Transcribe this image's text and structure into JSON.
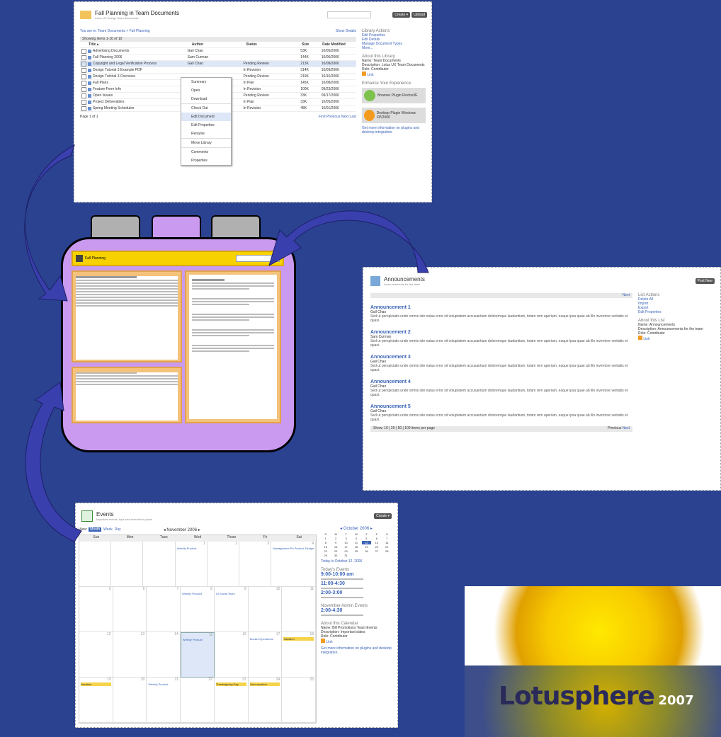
{
  "colors": {
    "background": "#2a4290",
    "device": "#c99af0",
    "panel": "#f4c27a",
    "header": "#f7d200",
    "link": "#3a63b8"
  },
  "doclib": {
    "title": "Fall Planning in Team Documents",
    "subtitle": "Lotus UX Design Team documents",
    "breadcrumb": "You are in: Team Documents > Fall Planning",
    "show_details": "Show Details",
    "create_button": "Create ▾",
    "upload_button": "Upload",
    "paging": "Showing items 1-10 of 10",
    "columns": [
      "Title ▴",
      "Author",
      "Status",
      "Size",
      "Date Modified"
    ],
    "rows": [
      {
        "title": "Advertising Documents",
        "author": "Gail Chao",
        "status": "",
        "size": "53K",
        "date": "10/05/2006"
      },
      {
        "title": "Fall Planning 2006",
        "author": "Sam Curman",
        "status": "",
        "size": "144K",
        "date": "10/06/2006"
      },
      {
        "title": "Copyright and Legal Verification Process",
        "author": "Gail Chao",
        "status": "Pending Review",
        "size": "213K",
        "date": "10/08/2006"
      },
      {
        "title": "Design Tutorial 3 Example PDF",
        "author": "",
        "status": "In Revision",
        "size": "314K",
        "date": "10/09/2006"
      },
      {
        "title": "Design Tutorial 3 Overview",
        "author": "",
        "status": "Pending Review",
        "size": "219K",
        "date": "10/10/2006"
      },
      {
        "title": "Fall Plans",
        "author": "",
        "status": "In Plan",
        "size": "145K",
        "date": "10/08/2006"
      },
      {
        "title": "Feature Form Info",
        "author": "",
        "status": "In Revision",
        "size": "100K",
        "date": "09/23/2006"
      },
      {
        "title": "Open Issues",
        "author": "",
        "status": "Pending Review",
        "size": "33K",
        "date": "09/17/2006"
      },
      {
        "title": "Project Deliverables",
        "author": "",
        "status": "In Plan",
        "size": "33K",
        "date": "10/05/2006"
      },
      {
        "title": "Spring Meeting Schedules",
        "author": "",
        "status": "In Revision",
        "size": "48K",
        "date": "10/01/2006"
      }
    ],
    "menu": [
      "Summary",
      "Open",
      "Download",
      "Check Out",
      "Edit Document",
      "Edit Properties",
      "Rename",
      "Move Library",
      "Comments",
      "Properties"
    ],
    "footer": "Page 1 of 1",
    "pager": [
      "First",
      "Previous",
      "Next",
      "Last"
    ],
    "side_title": "Library Actions",
    "side_links": [
      "Edit Properties",
      "Edit Details",
      "Manage Document Types",
      "More..."
    ],
    "about_title": "About this Library",
    "about_lines": [
      "Name: Team Documents",
      "Description: Lotus UX Team Documents",
      "Role: Contributor"
    ],
    "rss": "Link",
    "enhance_title": "Enhance Your Experience",
    "plugin1": "Browser Plugin Firefox/IE",
    "plugin2": "Desktop Plugin Windows XP/2000",
    "plugin_note": "Get more information on plugins and desktop integration."
  },
  "announcements": {
    "title": "Announcements",
    "subtitle": "Announcements for the team",
    "new_button": "Post New",
    "items": [
      {
        "title": "Announcement 1",
        "meta": "Gail Chao"
      },
      {
        "title": "Announcement 2",
        "meta": "Sam Curman"
      },
      {
        "title": "Announcement 3",
        "meta": "Gail Chao"
      },
      {
        "title": "Announcement 4",
        "meta": "Gail Chao"
      },
      {
        "title": "Announcement 5",
        "meta": "Gail Chao"
      }
    ],
    "body": "Sed ut perspiciatis unde omnis iste natus error sit voluptatem accusantium doloremque laudantium, totam rem aperiam, eaque ipsa quae ab illo inventore veritatis et quasi.",
    "pager_prev": "Previous",
    "pager_next": "Next",
    "show": "Show: 10 | 20 | 50 | 100 items per page",
    "side_title": "List Actions",
    "side_links": [
      "Delete All",
      "Import",
      "Export",
      "Edit Properties"
    ],
    "about_title": "About this List",
    "about_lines": [
      "Name: Announcements",
      "Description: Announcements for the team",
      "Role: Contributor"
    ],
    "rss": "Link"
  },
  "events": {
    "title": "Events",
    "subtitle": "Important events, trips and executive's plans",
    "create_button": "Create ▾",
    "views": [
      "View:",
      "Month",
      "Week",
      "Day"
    ],
    "month_label": "◂ November 2006 ▸",
    "days": [
      "Sun",
      "Mon",
      "Tues",
      "Wed",
      "Thurs",
      "Fri",
      "Sat"
    ],
    "weeks": [
      [
        "",
        "",
        "",
        "1",
        "2",
        "3",
        "4"
      ],
      [
        "5",
        "6",
        "7",
        "8",
        "9",
        "10",
        "11"
      ],
      [
        "12",
        "13",
        "14",
        "15",
        "16",
        "17",
        "18"
      ],
      [
        "19",
        "20",
        "21",
        "22",
        "23",
        "24",
        "25"
      ]
    ],
    "entries": [
      {
        "label": "Weekly Product",
        "cls": ""
      },
      {
        "label": "Weekly Product",
        "cls": ""
      },
      {
        "label": "UI Social Team",
        "cls": ""
      },
      {
        "label": "Weekly Product",
        "cls": ""
      },
      {
        "label": "Bucket Operations",
        "cls": ""
      },
      {
        "label": "Vacation",
        "cls": "yellow"
      },
      {
        "label": "Vacation",
        "cls": "yellow"
      },
      {
        "label": "Weekly Product",
        "cls": ""
      },
      {
        "label": "Thanksgiving Day",
        "cls": "yellow"
      },
      {
        "label": "Own vacation",
        "cls": "yellow"
      },
      {
        "label": "Management Ph Product Design",
        "cls": ""
      }
    ],
    "mini_month": "◂ October 2006 ▸",
    "mini_days": [
      "S",
      "M",
      "T",
      "W",
      "T",
      "F",
      "S"
    ],
    "mini_dates": [
      "1",
      "2",
      "3",
      "4",
      "5",
      "6",
      "7",
      "8",
      "9",
      "10",
      "11",
      "12",
      "13",
      "14",
      "15",
      "16",
      "17",
      "18",
      "19",
      "20",
      "21",
      "22",
      "23",
      "24",
      "25",
      "26",
      "27",
      "28",
      "29",
      "30",
      "31"
    ],
    "today_link": "Today is October 12, 2006",
    "todays_title": "Today's Events",
    "todays": [
      "9:00-10:00 am",
      "11:00-4:30",
      "2:00-3:00"
    ],
    "nov_title": "November Admin Events",
    "nov_event": "2:00-4:30",
    "about_title": "About this Calendar",
    "about_lines": [
      "Name: Bill Promotions Team Events",
      "Description: Important dates",
      "Role: Contributor"
    ],
    "rss": "Link",
    "note": "Get more information on plugins and desktop integration."
  },
  "device": {
    "header_label": "Fall Planning",
    "tabs": [
      "",
      "",
      ""
    ]
  },
  "logo": {
    "text": "Lotusphere",
    "year": "2007"
  }
}
